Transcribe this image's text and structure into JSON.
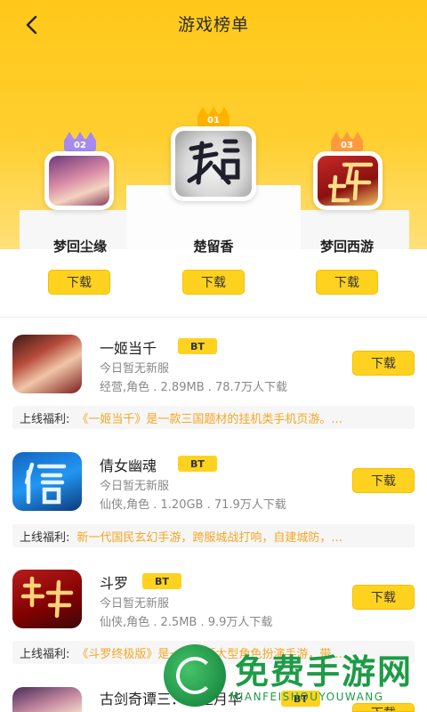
{
  "header": {
    "title": "游戏榜单"
  },
  "top3": [
    {
      "rank": "02",
      "name": "梦回尘缘",
      "download": "下载",
      "crown_color": "#a58bf0"
    },
    {
      "rank": "01",
      "name": "楚留香",
      "download": "下载",
      "crown_color": "#ffb300"
    },
    {
      "rank": "03",
      "name": "梦回西游",
      "download": "下载",
      "crown_color": "#ff9a3c"
    }
  ],
  "list": [
    {
      "name": "一姬当千",
      "tag": "BT",
      "status": "今日暂无新服",
      "meta": "经营,角色 . 2.89MB . 78.7万人下载",
      "download": "下载",
      "benefit_label": "上线福利:",
      "benefit": "《一姬当千》是一款三国题材的挂机类手机页游。..."
    },
    {
      "name": "倩女幽魂",
      "tag": "BT",
      "status": "今日暂无新服",
      "meta": "仙侠,角色 . 1.20GB . 71.9万人下载",
      "download": "下载",
      "benefit_label": "上线福利:",
      "benefit": "新一代国民玄幻手游，跨服城战打响，自建城防，..."
    },
    {
      "name": "斗罗",
      "tag": "BT",
      "status": "今日暂无新服",
      "meta": "仙侠,角色 . 2.5MB . 9.9万人下载",
      "download": "下载",
      "benefit_label": "上线福利:",
      "benefit": "《斗罗终极版》是一款竖版大型角色扮演手游，带..."
    },
    {
      "name": "古剑奇谭三：剑逐月华",
      "tag": "BT",
      "download": "下载"
    }
  ],
  "watermark": {
    "title": "免费手游网",
    "subtitle": "MIANFEISHOUYOUWANG"
  },
  "colors": {
    "accent": "#ffd21f",
    "benefit_text": "#f5a623"
  }
}
